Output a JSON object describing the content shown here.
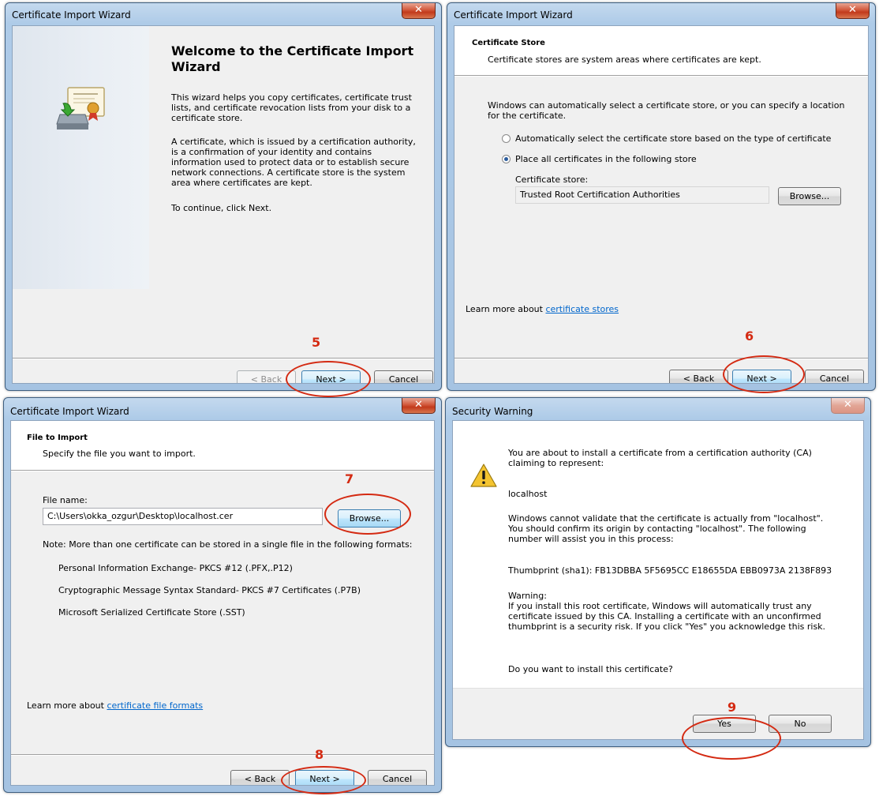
{
  "welcome": {
    "window_title": "Certificate Import Wizard",
    "heading": "Welcome to the Certificate Import Wizard",
    "para1": "This wizard helps you copy certificates, certificate trust lists, and certificate revocation lists from your disk to a certificate store.",
    "para2": "A certificate, which is issued by a certification authority, is a confirmation of your identity and contains information used to protect data or to establish secure network connections. A certificate store is the system area where certificates are kept.",
    "para3": "To continue, click Next.",
    "back_label": "< Back",
    "next_label": "Next >",
    "cancel_label": "Cancel",
    "step": "5"
  },
  "store": {
    "window_title": "Certificate Import Wizard",
    "section_title": "Certificate Store",
    "section_desc": "Certificate stores are system areas where certificates are kept.",
    "intro": "Windows can automatically select a certificate store, or you can specify a location for the certificate.",
    "radio_auto_label": "Automatically select the certificate store based on the type of certificate",
    "radio_place_label": "Place all certificates in the following store",
    "store_label": "Certificate store:",
    "store_value": "Trusted Root Certification Authorities",
    "browse_label": "Browse...",
    "learn_more_prefix": "Learn more about ",
    "learn_more_link": "certificate stores",
    "back_label": "< Back",
    "next_label": "Next >",
    "cancel_label": "Cancel",
    "step": "6"
  },
  "file": {
    "window_title": "Certificate Import Wizard",
    "section_title": "File to Import",
    "section_desc": "Specify the file you want to import.",
    "file_label": "File name:",
    "file_value": "C:\\Users\\okka_ozgur\\Desktop\\localhost.cer",
    "browse_label": "Browse...",
    "note": "Note:  More than one certificate can be stored in a single file in the following formats:",
    "formats": [
      "Personal Information Exchange- PKCS #12 (.PFX,.P12)",
      "Cryptographic Message Syntax Standard- PKCS #7 Certificates (.P7B)",
      "Microsoft Serialized Certificate Store (.SST)"
    ],
    "learn_more_prefix": "Learn more about ",
    "learn_more_link": "certificate file formats",
    "back_label": "< Back",
    "next_label": "Next >",
    "cancel_label": "Cancel",
    "step_browse": "7",
    "step_next": "8"
  },
  "warning": {
    "window_title": "Security Warning",
    "line1": "You are about to install a certificate from a certification authority (CA) claiming to represent:",
    "host": "localhost",
    "para2": "Windows cannot validate that the certificate is actually from \"localhost\". You should confirm its origin by contacting \"localhost\". The following number will assist you in this process:",
    "thumbprint": "Thumbprint (sha1): FB13DBBA 5F5695CC E18655DA EBB0973A 2138F893",
    "warning_title": "Warning:",
    "warning_text": "If you install this root certificate, Windows will automatically trust any certificate issued by this CA. Installing a certificate with an unconfirmed thumbprint is a security risk. If you click \"Yes\" you acknowledge this risk.",
    "question": "Do you want to install this certificate?",
    "yes_label": "Yes",
    "no_label": "No",
    "step": "9"
  },
  "icons": {
    "close": "close-icon",
    "certificate": "certificate-icon",
    "warning": "warning-icon"
  }
}
